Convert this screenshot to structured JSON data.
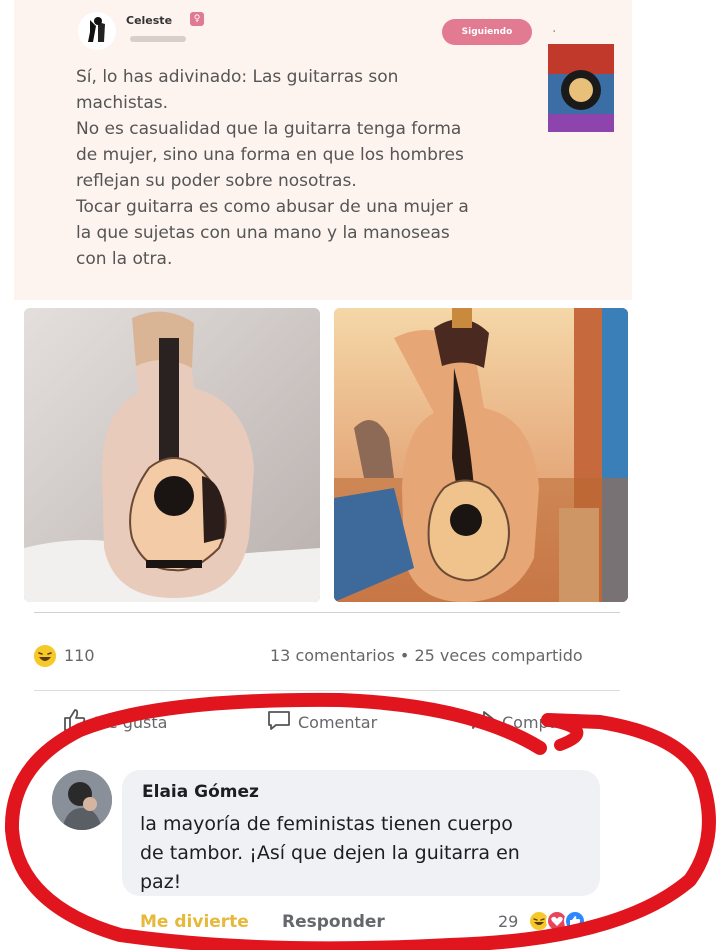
{
  "embedded_post": {
    "user_name": "Celeste",
    "follow_label": "Siguiendo",
    "text_lines": [
      "Sí, lo has adivinado: Las guitarras son",
      "machistas.",
      "No es casualidad que la guitarra tenga forma",
      "de mujer, sino una forma en que los hombres",
      "reflejan su poder sobre nosotras.",
      "Tocar guitarra es como abusar de una mujer a",
      "la que sujetas con una mano y la manoseas",
      "con la otra."
    ]
  },
  "post_stats": {
    "reaction_count": "110",
    "comments_shares": "13 comentarios • 25 veces compartido"
  },
  "actions": {
    "like": "Me gusta",
    "comment": "Comentar",
    "share": "Compartir"
  },
  "comment": {
    "author": "Elaia Gómez",
    "text_lines": [
      "la mayoría de feministas tienen cuerpo",
      "de tambor. ¡Así que dejen la guitarra en",
      "paz!"
    ],
    "reaction_label": "Me divierte",
    "reply_label": "Responder",
    "reaction_count": "29"
  },
  "colors": {
    "follow_button": "#e27a92",
    "funny_accent": "#e6b93a",
    "highlight_circle": "#e0151d"
  },
  "icons": [
    "laugh-emoji-icon",
    "like-icon",
    "comment-icon",
    "share-icon",
    "love-emoji-icon",
    "thumbs-up-emoji-icon"
  ]
}
